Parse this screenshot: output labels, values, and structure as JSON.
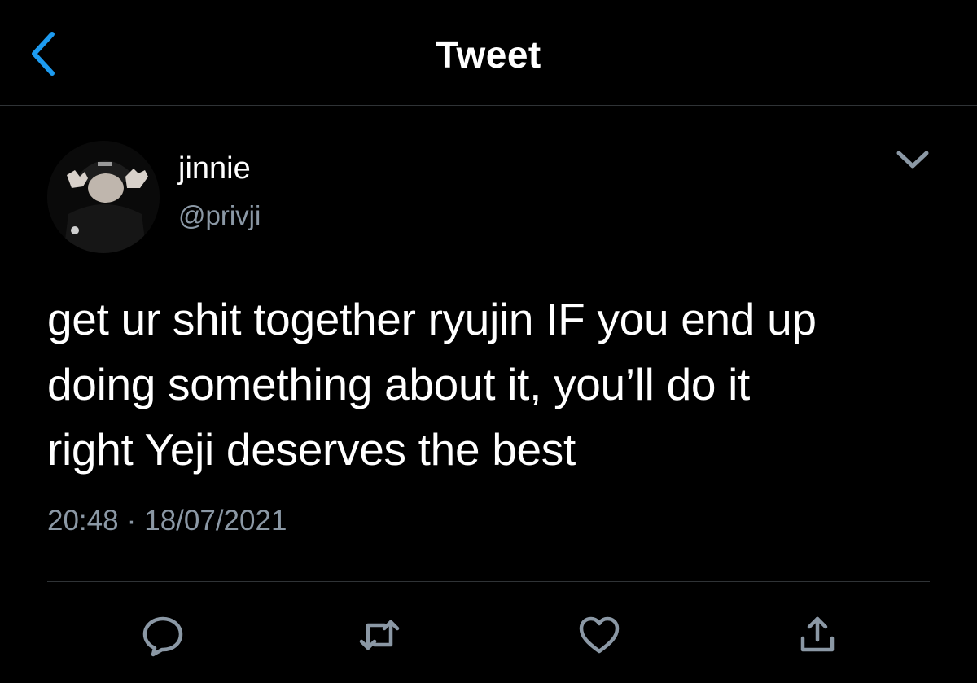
{
  "header": {
    "title": "Tweet",
    "back_icon": "chevron-left-icon"
  },
  "tweet": {
    "author": {
      "display_name": "jinnie",
      "handle": "@privji",
      "avatar": "avatar-photo"
    },
    "text": "get ur shit together ryujin IF you end up\ndoing something about it, you’ll do it\nright Yeji deserves the best",
    "time": "20:48",
    "separator": "·",
    "date": "18/07/2021",
    "menu_icon": "chevron-down-icon"
  },
  "actions": [
    {
      "name": "reply",
      "icon": "reply-icon"
    },
    {
      "name": "retweet",
      "icon": "retweet-icon"
    },
    {
      "name": "like",
      "icon": "heart-icon"
    },
    {
      "name": "share",
      "icon": "share-icon"
    }
  ],
  "colors": {
    "background": "#000000",
    "accent": "#1d9bf0",
    "text_primary": "#ffffff",
    "text_secondary": "#8b98a5",
    "divider": "#2f3336"
  }
}
